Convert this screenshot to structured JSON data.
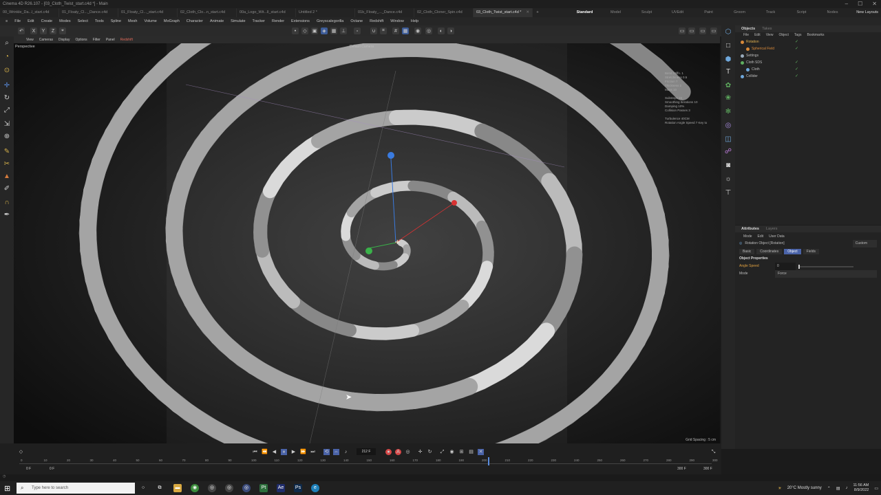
{
  "window": {
    "title": "Cinema 4D R26.107 - [03_Cloth_Twist_start.c4d *] - Main"
  },
  "tabs": [
    {
      "label": "00_Wrinkle_Da...l_start.c4d"
    },
    {
      "label": "01_Floaty_Cl..._Dance.c4d"
    },
    {
      "label": "01_Floaty_Cl..._start.c4d"
    },
    {
      "label": "02_Cloth_Clo...n_start.c4d"
    },
    {
      "label": "00a_Logo_Wit...ll_start.c4d"
    },
    {
      "label": "Untitled 2 *"
    },
    {
      "label": "01b_Floaty_..._Dance.c4d"
    },
    {
      "label": "02_Cloth_Cloner_Spin.c4d"
    },
    {
      "label": "03_Cloth_Twist_start.c4d *",
      "active": true
    }
  ],
  "layouts": [
    "Standard",
    "Model",
    "Sculpt",
    "UVEdit",
    "Paint",
    "Groom",
    "Track",
    "Script",
    "Nodes"
  ],
  "new_layouts": "New Layouts",
  "menu": [
    "File",
    "Edit",
    "Create",
    "Modes",
    "Select",
    "Tools",
    "Spline",
    "Mesh",
    "Volume",
    "MoGraph",
    "Character",
    "Animate",
    "Simulate",
    "Tracker",
    "Render",
    "Extensions",
    "Greyscalegorilla",
    "Octane",
    "Redshift",
    "Window",
    "Help"
  ],
  "viewport_menu": [
    "View",
    "Cameras",
    "Display",
    "Options",
    "Filter",
    "Panel",
    "Redshift"
  ],
  "viewport": {
    "label": "Perspective",
    "camera": "Default Camera",
    "grid_spacing": "Grid Spacing : 5 cm",
    "hud": [
      "Bend Stiffn. 1",
      "Stretchiness 0.5",
      "Friction 7",
      "Thickness 2",
      "Mass 10",
      "",
      "Substeps 15",
      "Smoothing Iterations 10",
      "Damping 10%",
      "Collision Passes 3",
      "",
      "Turbulence 40CM",
      "Rotation Angle Speed 7 Key to"
    ]
  },
  "objects_panel": {
    "tabs": [
      "Objects",
      "Takes"
    ],
    "menu": [
      "File",
      "Edit",
      "View",
      "Object",
      "Tags",
      "Bookmarks"
    ],
    "items": [
      {
        "name": "Rotation",
        "color": "#d98a3a",
        "indent": 0
      },
      {
        "name": "Spherical Field",
        "color": "#d98a3a",
        "indent": 1
      },
      {
        "name": "Settings",
        "color": "#9ab",
        "indent": 0
      },
      {
        "name": "Cloth SDS",
        "color": "#5fae5f",
        "indent": 0
      },
      {
        "name": "Cloth",
        "color": "#6fa8dc",
        "indent": 1
      },
      {
        "name": "Collider",
        "color": "#6fa8dc",
        "indent": 0
      }
    ]
  },
  "attributes_panel": {
    "tabs": [
      "Attributes",
      "Layers"
    ],
    "menu": [
      "Mode",
      "Edit",
      "User Data"
    ],
    "object_title": "Rotation Object [Rotation]",
    "preset": "Custom",
    "subtabs": [
      "Basic",
      "Coordinates",
      "Object",
      "Fields"
    ],
    "active_subtab": "Object",
    "section": "Object Properties",
    "angle_speed_label": "Angle Speed",
    "angle_speed_value": "0",
    "mode_label": "Mode",
    "mode_value": "Force"
  },
  "timeline": {
    "current_frame": "212 F",
    "start": "0 F",
    "start2": "0 F",
    "end": "300 F",
    "end2": "300 F",
    "ticks": [
      "0",
      "10",
      "20",
      "30",
      "40",
      "50",
      "60",
      "70",
      "80",
      "90",
      "100",
      "110",
      "120",
      "130",
      "140",
      "150",
      "160",
      "170",
      "180",
      "190",
      "200",
      "210",
      "220",
      "230",
      "240",
      "250",
      "260",
      "270",
      "280",
      "290",
      "300"
    ]
  },
  "taskbar": {
    "search_placeholder": "Type here to search",
    "weather": "20°C  Mostly sunny",
    "time": "11:56 AM",
    "date": "8/9/2022"
  },
  "colors": {
    "accent": "#4a63a8",
    "record": "#d64848",
    "objects_active": "#e0b050"
  }
}
